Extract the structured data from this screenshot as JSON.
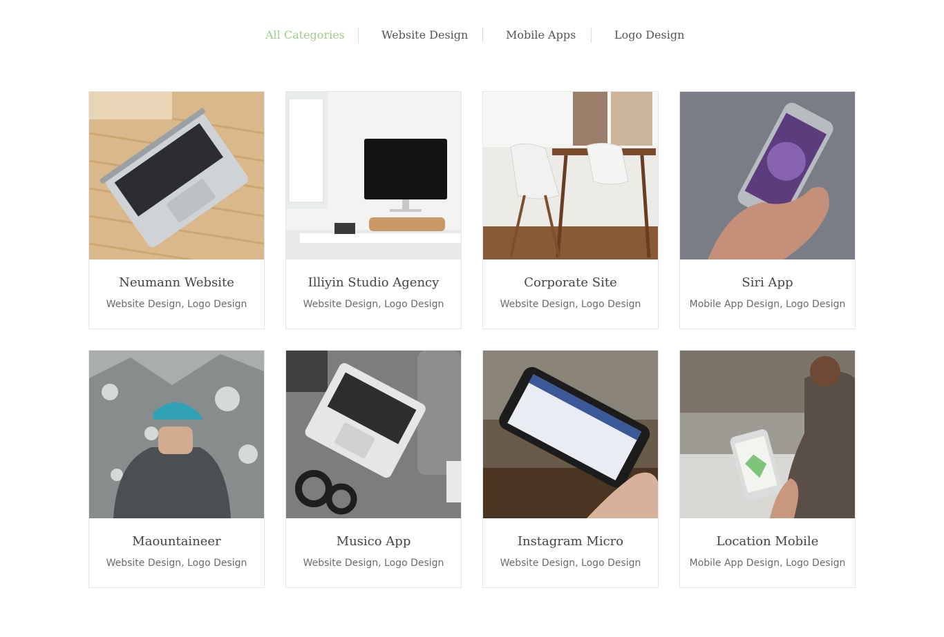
{
  "filters": [
    {
      "label": "All Categories",
      "active": true
    },
    {
      "label": "Website Design",
      "active": false
    },
    {
      "label": "Mobile Apps",
      "active": false
    },
    {
      "label": "Logo Design",
      "active": false
    }
  ],
  "colors": {
    "accent": "#9fcd8a",
    "text": "#444444",
    "muted": "#6b6b6b",
    "border": "#e6e6e6"
  },
  "portfolio": [
    {
      "title": "Neumann Website",
      "tags": "Website Design, Logo Design",
      "image_icon": "laptop-on-wicker-icon"
    },
    {
      "title": "Illiyin Studio Agency",
      "tags": "Website Design, Logo Design",
      "image_icon": "desktop-workspace-icon"
    },
    {
      "title": "Corporate Site",
      "tags": "Website Design, Logo Design",
      "image_icon": "dining-chairs-icon"
    },
    {
      "title": "Siri App",
      "tags": "Mobile App Design, Logo Design",
      "image_icon": "phone-in-hand-icon"
    },
    {
      "title": "Maountaineer",
      "tags": "Website Design, Logo Design",
      "image_icon": "hiker-mountain-icon"
    },
    {
      "title": "Musico App",
      "tags": "Website Design, Logo Design",
      "image_icon": "laptop-headphones-icon"
    },
    {
      "title": "Instagram Micro",
      "tags": "Website Design, Logo Design",
      "image_icon": "phone-landscape-icon"
    },
    {
      "title": "Location Mobile",
      "tags": "Mobile App Design, Logo Design",
      "image_icon": "phone-map-icon"
    }
  ]
}
